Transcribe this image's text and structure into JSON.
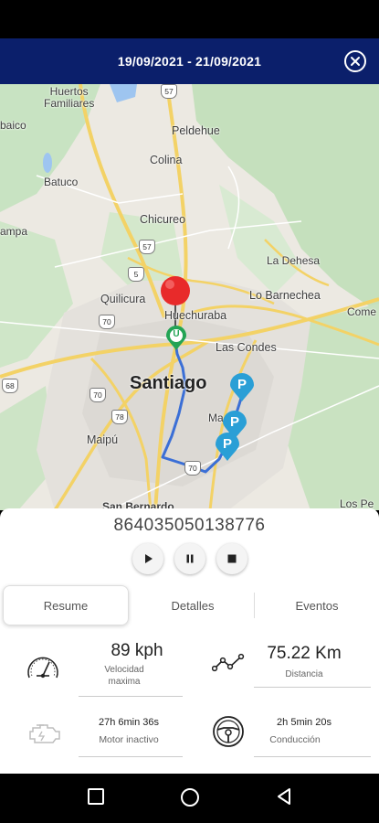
{
  "header": {
    "title": "19/09/2021 - 21/09/2021"
  },
  "map": {
    "places": {
      "huertos": "Huertos\nFamiliares",
      "peldehue": "Peldehue",
      "baico": "baico",
      "colina": "Colina",
      "batuco": "Batuco",
      "ampa": "ampa",
      "chicureo": "Chicureo",
      "ladehesa": "La Dehesa",
      "quilicura": "Quilicura",
      "huechuraba": "Huechuraba",
      "lobarnechea": "Lo Barnechea",
      "come": "Come",
      "lascondes": "Las Condes",
      "santiago": "Santiago",
      "ma": "Ma",
      "maipu": "Maipú",
      "sanbernardo": "San Bernardo",
      "lospe": "Los Pe"
    },
    "shields": {
      "s57a": "57",
      "s57b": "57",
      "s5": "5",
      "s70": "70",
      "s68": "68",
      "s70b": "70",
      "s78": "78",
      "s70c": "70"
    },
    "start_marker": "U",
    "stop_marker": "P"
  },
  "panel": {
    "device_id": "864035050138776",
    "tabs": [
      "Resume",
      "Detalles",
      "Eventos"
    ],
    "stats": {
      "speed_value": "89 kph",
      "speed_label": "Velocidad\nmaxima",
      "distance_value": "75.22 Km",
      "distance_label": "Distancia",
      "idle_value": "27h 6min 36s",
      "idle_label": "Motor inactivo",
      "driving_value": "2h 5min 20s",
      "driving_label": "Conducción"
    }
  },
  "colors": {
    "header": "#0b1f6b",
    "route": "#3b6fd6",
    "parking": "#2a9fd6",
    "start": "#23a455",
    "pin": "#e82a2a"
  }
}
